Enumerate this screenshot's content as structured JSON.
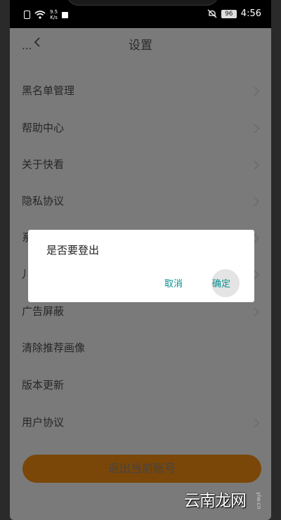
{
  "status_bar": {
    "net_speed": "9.5\nK/s",
    "battery": "96",
    "time": "4:56"
  },
  "header": {
    "title": "设置"
  },
  "settings": {
    "items": [
      {
        "label": "...",
        "partial": true
      },
      {
        "label": "黑名单管理"
      },
      {
        "label": "帮助中心"
      },
      {
        "label": "关于快看"
      },
      {
        "label": "隐私协议"
      },
      {
        "label": "系..."
      },
      {
        "label": "儿..."
      },
      {
        "label": "广告屏蔽"
      },
      {
        "label": "清除推荐画像"
      },
      {
        "label": "版本更新"
      },
      {
        "label": "用户协议"
      }
    ],
    "logout_label": "退出当前账号"
  },
  "dialog": {
    "message": "是否要登出",
    "cancel_label": "取消",
    "confirm_label": "确定"
  },
  "watermark": {
    "text": "云南龙网",
    "sub": "ylw.cn"
  },
  "colors": {
    "accent": "#0b8f8f",
    "logout_button": "#7a4709",
    "overlay": "#7a7a7a"
  }
}
